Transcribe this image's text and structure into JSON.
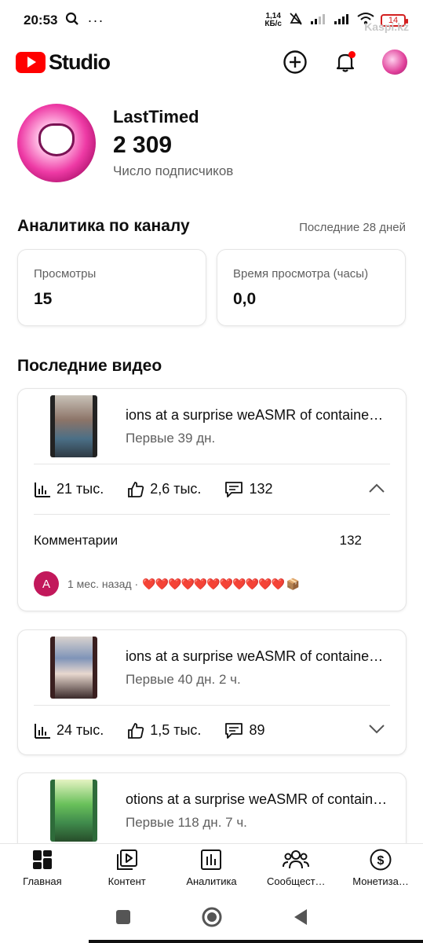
{
  "status_bar": {
    "time": "20:53",
    "netspeed_value": "1,14",
    "netspeed_unit": "КБ/с",
    "battery": "14",
    "watermark": "Kaspi.kz"
  },
  "app_bar": {
    "logo_text": "Studio"
  },
  "channel": {
    "name": "LastTimed",
    "subscribers": "2 309",
    "subscribers_label": "Число подписчиков"
  },
  "analytics": {
    "title": "Аналитика по каналу",
    "period": "Последние 28 дней",
    "metrics": [
      {
        "label": "Просмотры",
        "value": "15"
      },
      {
        "label": "Время просмотра (часы)",
        "value": "0,0"
      }
    ]
  },
  "recent_videos": {
    "title": "Последние видео",
    "items": [
      {
        "title": "ions at a surprise weASMR of containe…",
        "age": "Первые 39 дн.",
        "views": "21 тыс.",
        "likes": "2,6 тыс.",
        "comments": "132",
        "expanded": true,
        "comments_label": "Комментарии",
        "comments_count": "132",
        "latest_comment": {
          "avatar_letter": "A",
          "meta": "1 мес. назад ·",
          "text": "❤️❤️❤️❤️❤️❤️❤️❤️❤️❤️❤️ 📦"
        }
      },
      {
        "title": "ions at a surprise weASMR of containe…",
        "age": "Первые 40 дн. 2 ч.",
        "views": "24 тыс.",
        "likes": "1,5 тыс.",
        "comments": "89",
        "expanded": false
      },
      {
        "title": "otions at a surprise weASMR of contain…",
        "age": "Первые 118 дн. 7 ч."
      }
    ]
  },
  "bottom_nav": [
    {
      "label": "Главная",
      "icon": "dashboard-icon"
    },
    {
      "label": "Контент",
      "icon": "content-icon"
    },
    {
      "label": "Аналитика",
      "icon": "analytics-icon"
    },
    {
      "label": "Сообщест…",
      "icon": "community-icon"
    },
    {
      "label": "Монетиза…",
      "icon": "monetization-icon"
    }
  ],
  "colors": {
    "brand_red": "#ff0000",
    "text_primary": "#0f0f0f",
    "text_secondary": "#606060",
    "comment_avatar": "#c2185b"
  }
}
